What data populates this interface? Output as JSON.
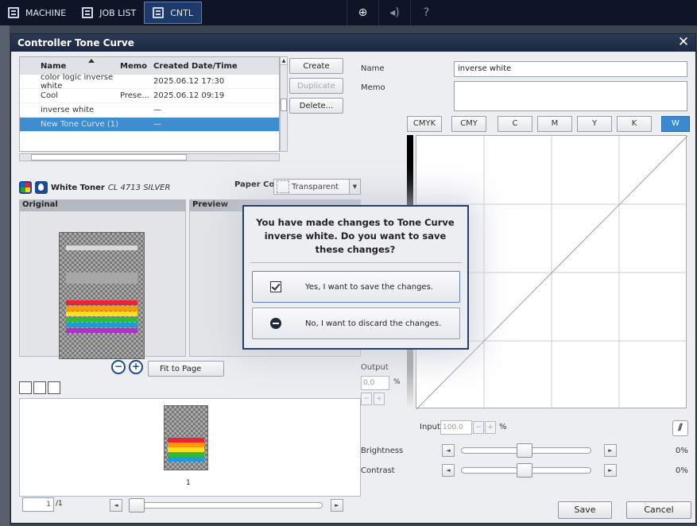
{
  "topbar": {
    "tabs": [
      {
        "label": "MACHINE"
      },
      {
        "label": "JOB LIST"
      },
      {
        "label": "CNTL"
      }
    ],
    "help_label": "?"
  },
  "window": {
    "title": "Controller Tone Curve"
  },
  "tone_list": {
    "headers": {
      "name": "Name",
      "memo": "Memo",
      "date": "Created Date/Time"
    },
    "rows": [
      {
        "name": "color logic inverse white",
        "memo": "",
        "date": "2025.06.12 17:30"
      },
      {
        "name": "Cool",
        "memo": "Prese...",
        "date": "2025.06.12 09:19"
      },
      {
        "name": "inverse white",
        "memo": "",
        "date": "—"
      },
      {
        "name": "New Tone Curve (1)",
        "memo": "",
        "date": "—"
      }
    ]
  },
  "list_buttons": {
    "create": "Create",
    "duplicate": "Duplicate",
    "delete": "Delete..."
  },
  "toner": {
    "label": "White Toner",
    "value": "CL 4713 SILVER",
    "paper_color_label": "Paper Color",
    "paper_color_value": "Transparent"
  },
  "panes": {
    "original": "Original",
    "preview": "Preview",
    "fit": "Fit to Page"
  },
  "thumb_page_label": "1",
  "pager": {
    "current": "1",
    "total": "/1"
  },
  "form": {
    "name_label": "Name",
    "name_value": "inverse white",
    "memo_label": "Memo"
  },
  "channels": [
    "CMYK",
    "CMY",
    "C",
    "M",
    "Y",
    "K",
    "W"
  ],
  "active_channel": "W",
  "output": {
    "label": "Output",
    "value": "0.0",
    "unit": "%"
  },
  "input": {
    "label": "Input",
    "value": "100.0",
    "unit": "%"
  },
  "brightness": {
    "label": "Brightness",
    "value": "0%"
  },
  "contrast": {
    "label": "Contrast",
    "value": "0%"
  },
  "footer": {
    "save": "Save",
    "cancel": "Cancel"
  },
  "dialog": {
    "message": "You have made changes to Tone Curve inverse white. Do you want to save these changes?",
    "save_option": "Yes, I want to save the changes.",
    "discard_option": "No, I want to discard the changes."
  },
  "colors": {
    "titlebar": "#1d2841",
    "selected_row": "#3e8dd0",
    "active_channel": "#3b8ad1",
    "dialog_border": "#24406d"
  }
}
